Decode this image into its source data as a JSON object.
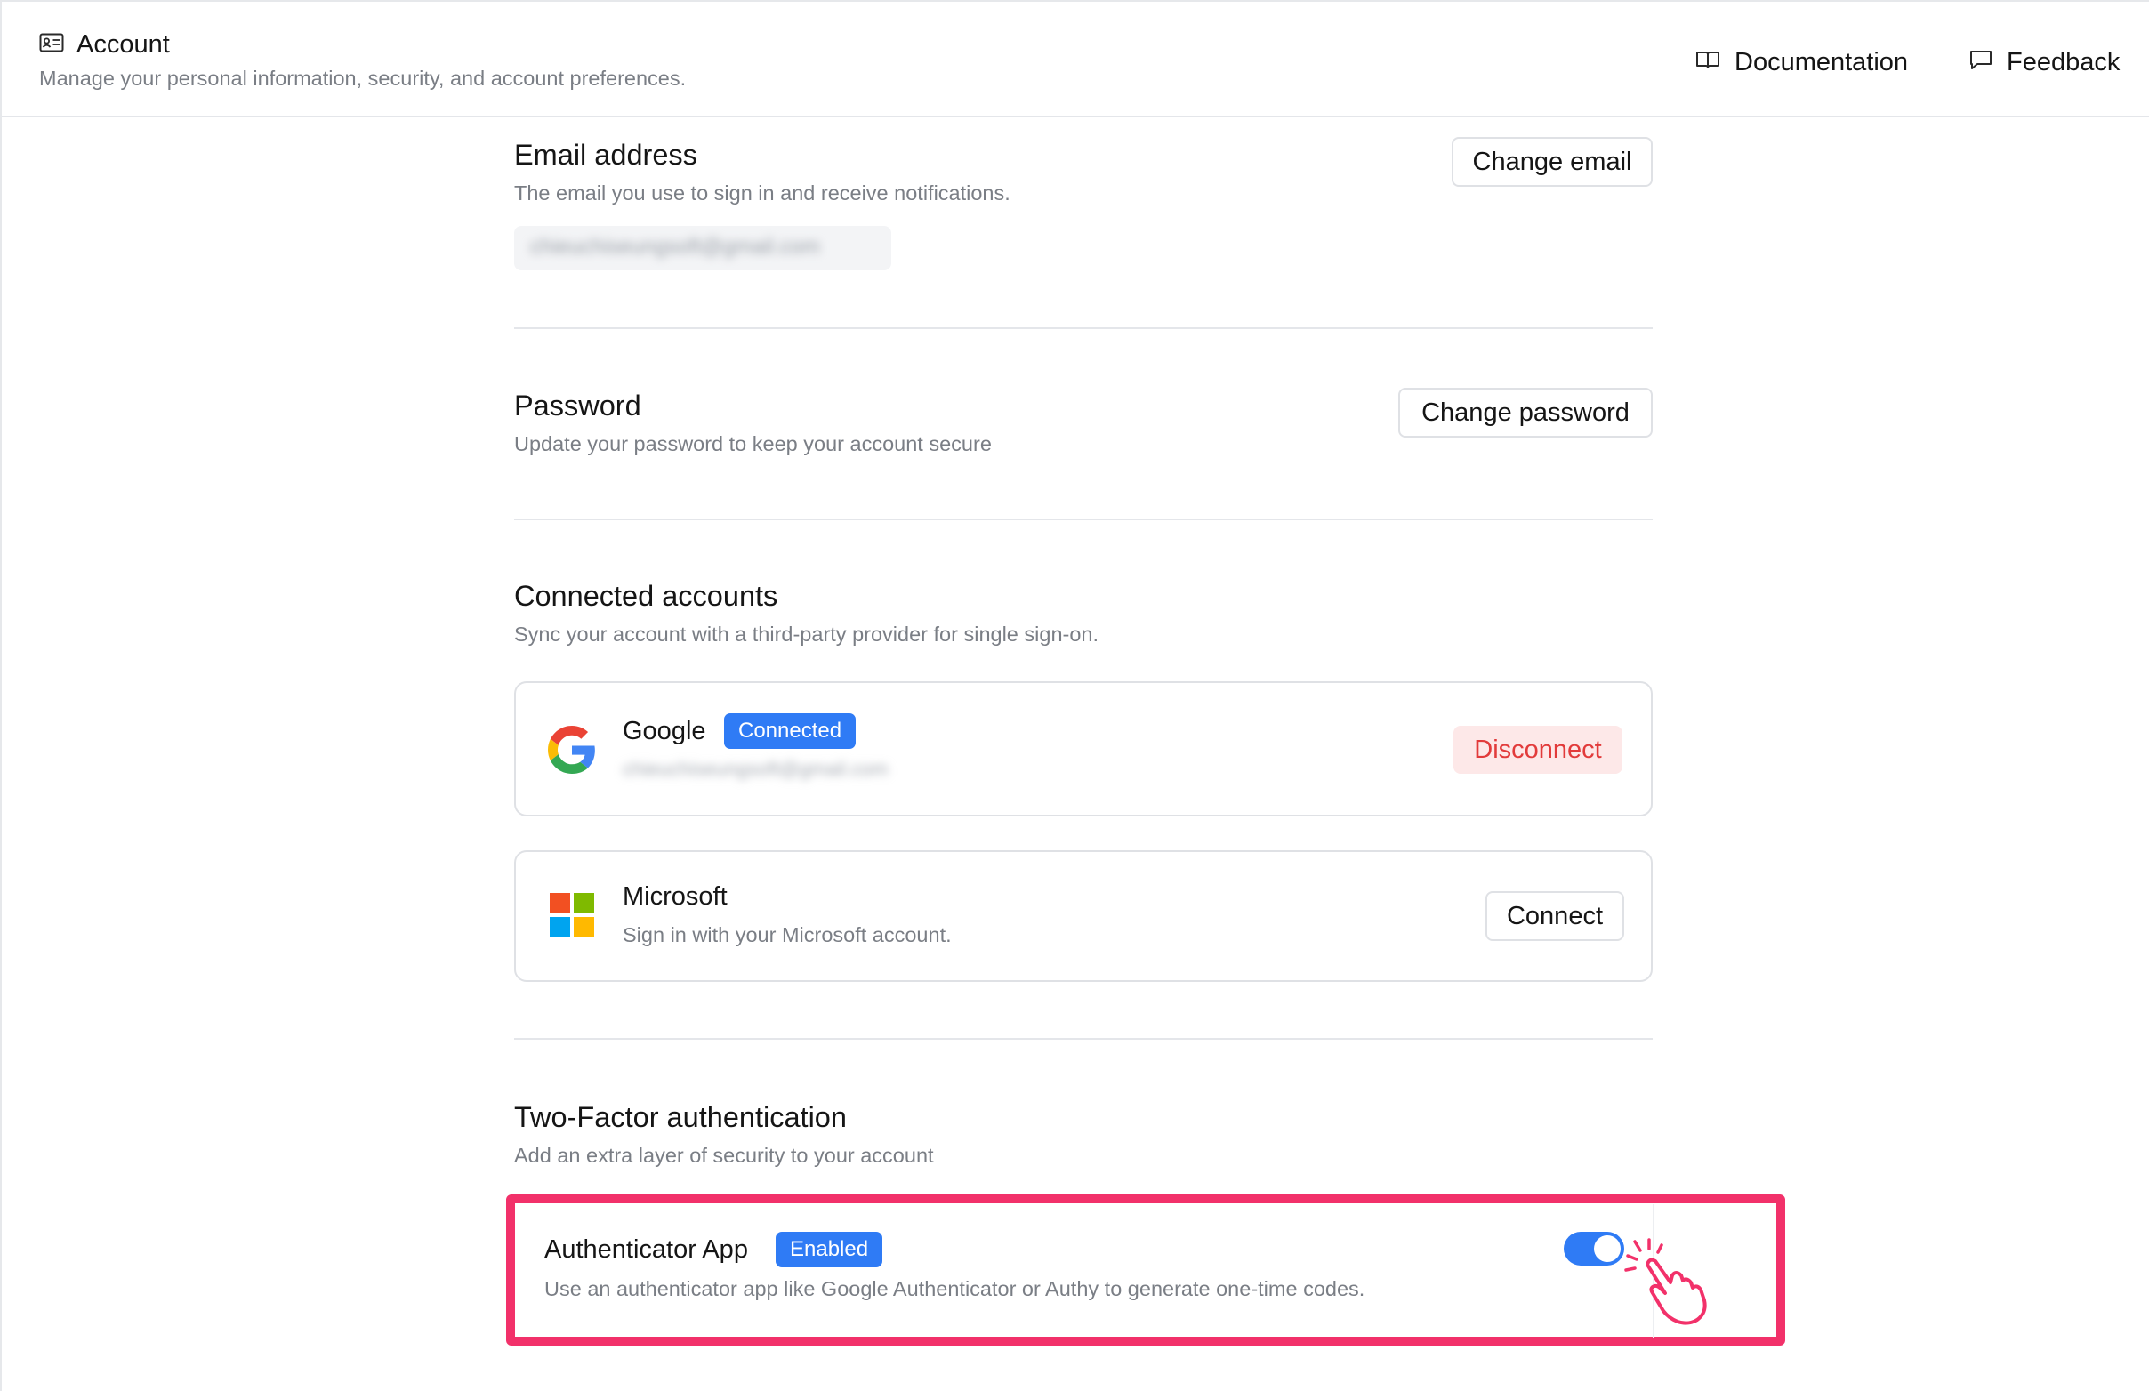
{
  "header": {
    "title": "Account",
    "title_icon": "id-card-icon",
    "subtitle": "Manage your personal information, security, and account preferences.",
    "links": [
      {
        "label": "Documentation",
        "icon": "book-open-icon"
      },
      {
        "label": "Feedback",
        "icon": "message-square-icon"
      }
    ]
  },
  "email": {
    "title": "Email address",
    "description": "The email you use to sign in and receive notifications.",
    "value": "chieuchiseungsoft@gmail.com",
    "button": "Change email"
  },
  "password": {
    "title": "Password",
    "description": "Update your password to keep your account secure",
    "button": "Change password"
  },
  "connected": {
    "title": "Connected accounts",
    "description": "Sync your account with a third-party provider for single sign-on.",
    "providers": [
      {
        "name": "Google",
        "icon": "google-icon",
        "badge": "Connected",
        "email": "chieuchiseungsoft@gmail.com",
        "action": "Disconnect"
      },
      {
        "name": "Microsoft",
        "icon": "microsoft-icon",
        "description": "Sign in with your Microsoft account.",
        "action": "Connect"
      }
    ]
  },
  "twofa": {
    "title": "Two-Factor authentication",
    "description": "Add an extra layer of security to your account",
    "app": {
      "name": "Authenticator App",
      "badge": "Enabled",
      "description": "Use an authenticator app like Google Authenticator or Authy to generate one-time codes.",
      "enabled": true
    }
  },
  "colors": {
    "accent": "#2f7bf5",
    "danger": "#e23b3b",
    "highlight": "#f2316a"
  }
}
